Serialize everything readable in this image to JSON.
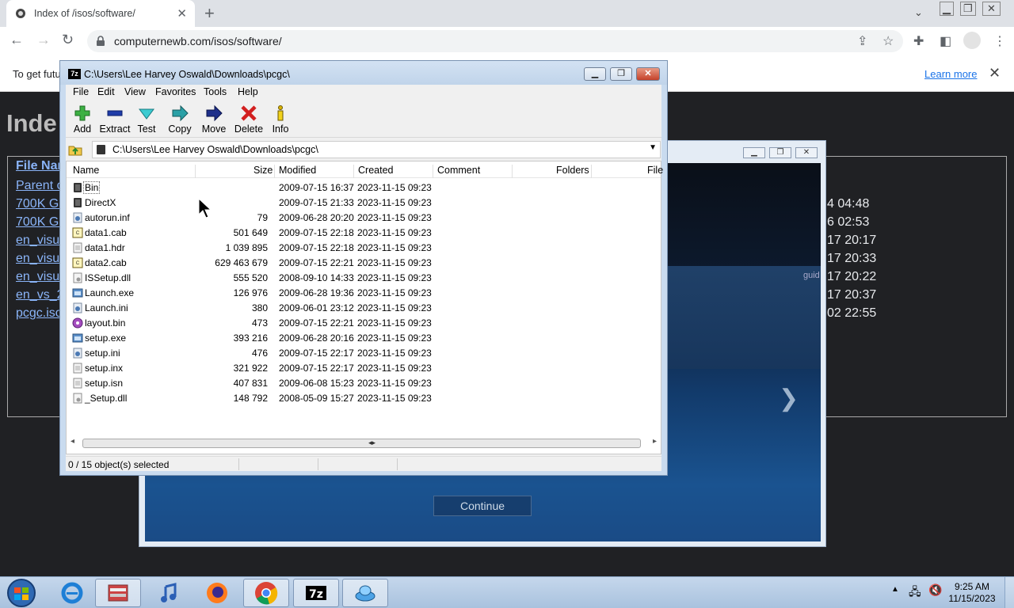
{
  "browser": {
    "tab_title": "Index of /isos/software/",
    "url": "computernewb.com/isos/software/",
    "infobar_message": "To get futu",
    "infobar_link": "Learn more"
  },
  "page": {
    "heading": "Inde",
    "column_header": "File Nar",
    "links": [
      "Parent o",
      "700K Ga",
      "700K Ga",
      "en_visu",
      "en_visu",
      "en_visu",
      "en_vs_2",
      "pcgc.iso"
    ],
    "dates": [
      "4 04:48",
      "6 02:53",
      "17 20:17",
      "17 20:33",
      "17 20:22",
      "17 20:37",
      "02 22:55"
    ]
  },
  "installer": {
    "guide_text": "guid",
    "continue_label": "Continue"
  },
  "sevenzip": {
    "title": "C:\\Users\\Lee Harvey Oswald\\Downloads\\pcgc\\",
    "menu": [
      "File",
      "Edit",
      "View",
      "Favorites",
      "Tools",
      "Help"
    ],
    "toolbar": [
      "Add",
      "Extract",
      "Test",
      "Copy",
      "Move",
      "Delete",
      "Info"
    ],
    "path": "C:\\Users\\Lee Harvey Oswald\\Downloads\\pcgc\\",
    "columns": [
      "Name",
      "Size",
      "Modified",
      "Created",
      "Comment",
      "Folders",
      "File"
    ],
    "files": [
      {
        "name": "Bin",
        "size": "",
        "modified": "2009-07-15 16:37",
        "created": "2023-11-15 09:23",
        "icon": "folder-icon"
      },
      {
        "name": "DirectX",
        "size": "",
        "modified": "2009-07-15 21:33",
        "created": "2023-11-15 09:23",
        "icon": "folder-icon"
      },
      {
        "name": "autorun.inf",
        "size": "79",
        "modified": "2009-06-28 20:20",
        "created": "2023-11-15 09:23",
        "icon": "settings-file-icon"
      },
      {
        "name": "data1.cab",
        "size": "501 649",
        "modified": "2009-07-15 22:18",
        "created": "2023-11-15 09:23",
        "icon": "cab-icon"
      },
      {
        "name": "data1.hdr",
        "size": "1 039 895",
        "modified": "2009-07-15 22:18",
        "created": "2023-11-15 09:23",
        "icon": "file-icon"
      },
      {
        "name": "data2.cab",
        "size": "629 463 679",
        "modified": "2009-07-15 22:21",
        "created": "2023-11-15 09:23",
        "icon": "cab-icon"
      },
      {
        "name": "ISSetup.dll",
        "size": "555 520",
        "modified": "2008-09-10 14:33",
        "created": "2023-11-15 09:23",
        "icon": "dll-icon"
      },
      {
        "name": "Launch.exe",
        "size": "126 976",
        "modified": "2009-06-28 19:36",
        "created": "2023-11-15 09:23",
        "icon": "exe-icon"
      },
      {
        "name": "Launch.ini",
        "size": "380",
        "modified": "2009-06-01 23:12",
        "created": "2023-11-15 09:23",
        "icon": "settings-file-icon"
      },
      {
        "name": "layout.bin",
        "size": "473",
        "modified": "2009-07-15 22:21",
        "created": "2023-11-15 09:23",
        "icon": "disc-icon"
      },
      {
        "name": "setup.exe",
        "size": "393 216",
        "modified": "2009-06-28 20:16",
        "created": "2023-11-15 09:23",
        "icon": "exe-icon"
      },
      {
        "name": "setup.ini",
        "size": "476",
        "modified": "2009-07-15 22:17",
        "created": "2023-11-15 09:23",
        "icon": "settings-file-icon"
      },
      {
        "name": "setup.inx",
        "size": "321 922",
        "modified": "2009-07-15 22:17",
        "created": "2023-11-15 09:23",
        "icon": "file-icon"
      },
      {
        "name": "setup.isn",
        "size": "407 831",
        "modified": "2009-06-08 15:23",
        "created": "2023-11-15 09:23",
        "icon": "file-icon"
      },
      {
        "name": "_Setup.dll",
        "size": "148 792",
        "modified": "2008-05-09 15:27",
        "created": "2023-11-15 09:23",
        "icon": "dll-icon"
      }
    ],
    "status": "0 / 15 object(s) selected"
  },
  "taskbar": {
    "time": "9:25 AM",
    "date": "11/15/2023",
    "apps": [
      "internet-explorer-icon",
      "installer-icon",
      "itunes-icon",
      "firefox-icon",
      "chrome-icon",
      "7zip-icon",
      "installer-disc-icon"
    ]
  }
}
